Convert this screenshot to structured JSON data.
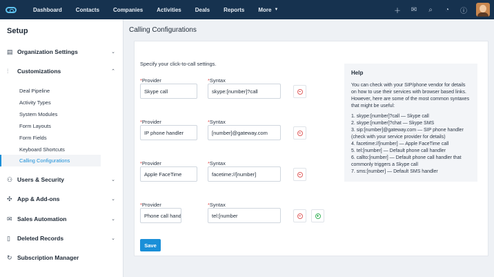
{
  "nav": {
    "items": [
      "Dashboard",
      "Contacts",
      "Companies",
      "Activities",
      "Deals",
      "Reports",
      "More"
    ]
  },
  "sidebar": {
    "title": "Setup",
    "sections": [
      {
        "label": "Organization Settings",
        "icon": "building-icon",
        "expanded": false
      },
      {
        "label": "Customizations",
        "icon": "sliders-icon",
        "expanded": true
      },
      {
        "label": "Users & Security",
        "icon": "user-icon",
        "expanded": false
      },
      {
        "label": "App & Add-ons",
        "icon": "puzzle-icon",
        "expanded": false
      },
      {
        "label": "Sales Automation",
        "icon": "mail-icon",
        "expanded": false
      },
      {
        "label": "Deleted Records",
        "icon": "trash-icon",
        "expanded": false
      },
      {
        "label": "Subscription Manager",
        "icon": "refresh-icon",
        "expanded": false
      }
    ],
    "sub_items": [
      "Deal Pipeline",
      "Activity Types",
      "System Modules",
      "Form Layouts",
      "Form Fields",
      "Keyboard Shortcuts",
      "Calling Configurations"
    ],
    "active_sub": "Calling Configurations"
  },
  "main": {
    "title": "Calling Configurations",
    "intro": "Specify your click-to-call settings.",
    "provider_label": "Provider",
    "syntax_label": "Syntax",
    "required_mark": "*",
    "rows": [
      {
        "provider": "Skype call",
        "syntax": "skype:[number]?call"
      },
      {
        "provider": "IP phone handler",
        "syntax": "[number]@gateway.com"
      },
      {
        "provider": "Apple FaceTime",
        "syntax": "facetime://[number]"
      },
      {
        "provider": "Phone call handle",
        "syntax": "tel:[number"
      }
    ],
    "save_label": "Save"
  },
  "help": {
    "title": "Help",
    "text": "You can check with your SIP/phone vendor for details on how to use their services with browser based links. However, here are some of the most common syntaxes that might be useful:",
    "items": [
      "1. skype:[number]?call — Skype call",
      "2. skype:[number]?chat — Skype SMS",
      "3. sip:[number]@gateway.com — SIP phone handler (check with your service provider for details)",
      "4. facetime://[number] — Apple FaceTime call",
      "5. tel:[number] — Default phone call handler",
      "6. callto:[number] — Default phone call handler that commonly triggers a Skype call",
      "7. sms:[number] — Default SMS handler"
    ]
  },
  "colors": {
    "topbar": "#16324f",
    "accent": "#1a8fd8",
    "required": "#e24b4b"
  }
}
